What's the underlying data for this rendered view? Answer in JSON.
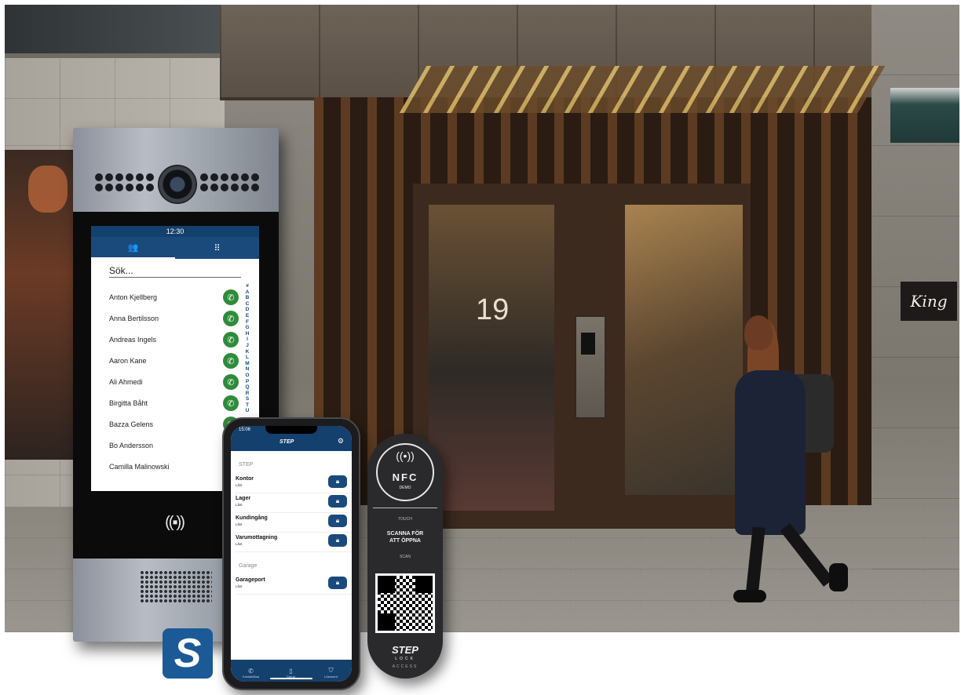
{
  "scene": {
    "door_number": "19",
    "shop_sign": "King"
  },
  "intercom": {
    "time": "12:30",
    "search_placeholder": "Sök...",
    "contacts": [
      "Anton Kjellberg",
      "Anna Bertilsson",
      "Andreas Ingels",
      "Aaron Kane",
      "Ali Ahmedi",
      "Birgitta Båht",
      "Bazza Gelens",
      "Bo Andersson",
      "Camilla Malinowski"
    ],
    "alphabet": "#ABCDEFGHIJKLMNOPQRSTU",
    "tab_icons": [
      "contacts-icon",
      "keypad-icon"
    ]
  },
  "phone": {
    "status_time": "15:06",
    "app_logo": "STEP",
    "group1": "STEP",
    "group1_items": [
      {
        "name": "Kontor",
        "status": "Låst"
      },
      {
        "name": "Lager",
        "status": "Låst"
      },
      {
        "name": "Kundingång",
        "status": "Låst"
      },
      {
        "name": "Varumottagning",
        "status": "Låst"
      }
    ],
    "group2": "Garage",
    "group2_items": [
      {
        "name": "Garageport",
        "status": "Låst"
      }
    ],
    "tabs": [
      "Kontaktlösa",
      "Dörrar",
      "Lösenord"
    ]
  },
  "nfc_tag": {
    "nfc": "NFC",
    "demo": "DEMO",
    "touch": "TOUCH",
    "scan_text_1": "SCANNA FÖR",
    "scan_text_2": "ATT ÖPPNA",
    "scan": "SCAN",
    "brand": "STEP",
    "lock": "LOCK",
    "access": "ACCESS"
  },
  "logo": {
    "letter": "S"
  },
  "colors": {
    "brand_blue": "#1a4a7c",
    "call_green": "#2e8b3a"
  }
}
